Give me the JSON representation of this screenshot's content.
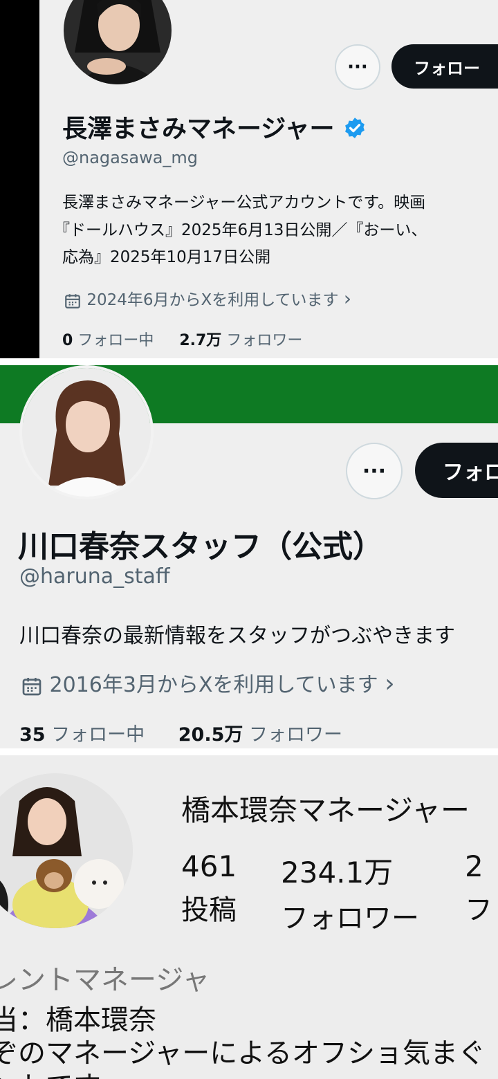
{
  "profile1": {
    "display_name": "長澤まさみマネージャー",
    "handle": "@nagasawa_mg",
    "follow_label": "フォロー",
    "more_label": "···",
    "bio_lines": [
      "長澤まさみマネージャー公式アカウントです。映画",
      "『ドールハウス』2025年6月13日公開／『おーい、",
      "応為』2025年10月17日公開"
    ],
    "joined": "2024年6月からXを利用しています",
    "joined_chevron": "›",
    "following_count": "0",
    "following_label": "フォロー中",
    "followers_count": "2.7万",
    "followers_label": "フォロワー",
    "verified_color": "#1d9bf0"
  },
  "profile2": {
    "display_name": "川口春奈スタッフ（公式）",
    "handle": "@haruna_staff",
    "follow_label": "フォロ",
    "more_label": "···",
    "bio": "川口春奈の最新情報をスタッフがつぶやきます",
    "joined": "2016年3月からXを利用しています",
    "joined_chevron": "›",
    "following_count": "35",
    "following_label": "フォロー中",
    "followers_count": "20.5万",
    "followers_label": "フォロワー",
    "banner_color": "#0e7a23"
  },
  "profile3": {
    "display_name": "橋本環奈マネージャー",
    "posts_count": "461",
    "posts_label": "投稿",
    "followers_count": "234.1万",
    "followers_label": "フォロワー",
    "following_count": "2",
    "following_label": "フ",
    "bio_lines": [
      "レントマネージャ",
      "当：橋本環奈",
      "ぞのマネージャーによるオフショ気まぐ",
      "ントです"
    ]
  }
}
